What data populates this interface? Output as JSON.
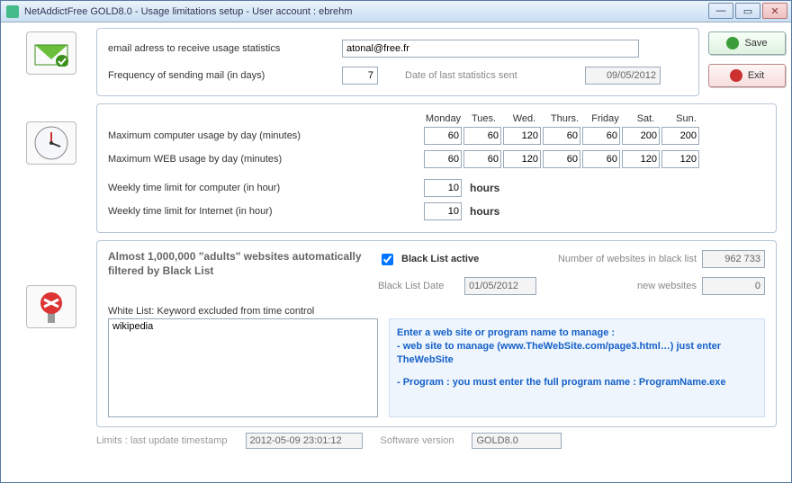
{
  "window": {
    "title": "NetAddictFree  GOLD8.0 - Usage limitations setup - User account : ebrehm"
  },
  "buttons": {
    "save": "Save",
    "exit": "Exit"
  },
  "email": {
    "label": "email adress to receive usage statistics",
    "value": "atonal@free.fr",
    "freq_label": "Frequency of sending mail (in days)",
    "freq_value": "7",
    "lastsent_label": "Date of last statistics sent",
    "lastsent_value": "09/05/2012"
  },
  "limits": {
    "days": [
      "Monday",
      "Tues.",
      "Wed.",
      "Thurs.",
      "Friday",
      "Sat.",
      "Sun."
    ],
    "comp_label": "Maximum computer usage by day (minutes)",
    "comp": [
      "60",
      "60",
      "120",
      "60",
      "60",
      "200",
      "200"
    ],
    "web_label": "Maximum WEB usage by day (minutes)",
    "web": [
      "60",
      "60",
      "120",
      "60",
      "60",
      "120",
      "120"
    ],
    "wk_comp_label": "Weekly time limit for computer (in hour)",
    "wk_comp": "10",
    "wk_net_label": "Weekly time limit for Internet (in hour)",
    "wk_net": "10",
    "hours_unit": "hours"
  },
  "blacklist": {
    "title": "Almost 1,000,000 \"adults\" websites automatically filtered by Black List",
    "active_label": "Black List active",
    "active": true,
    "count_label": "Number of websites in black list",
    "count": "962 733",
    "date_label": "Black List Date",
    "date": "01/05/2012",
    "new_label": "new websites",
    "new_value": "0",
    "whitelist_label": "White List: Keyword excluded from time control",
    "whitelist_value": "wikipedia",
    "help1": "Enter a web site or program name to manage :",
    "help2": "- web site to manage (www.TheWebSite.com/page3.html…) just enter TheWebSite",
    "help3": "- Program : you must enter the full program name : ProgramName.exe"
  },
  "footer": {
    "ts_label": "Limits : last update timestamp",
    "ts_value": "2012-05-09 23:01:12",
    "ver_label": "Software version",
    "ver_value": "GOLD8.0"
  }
}
